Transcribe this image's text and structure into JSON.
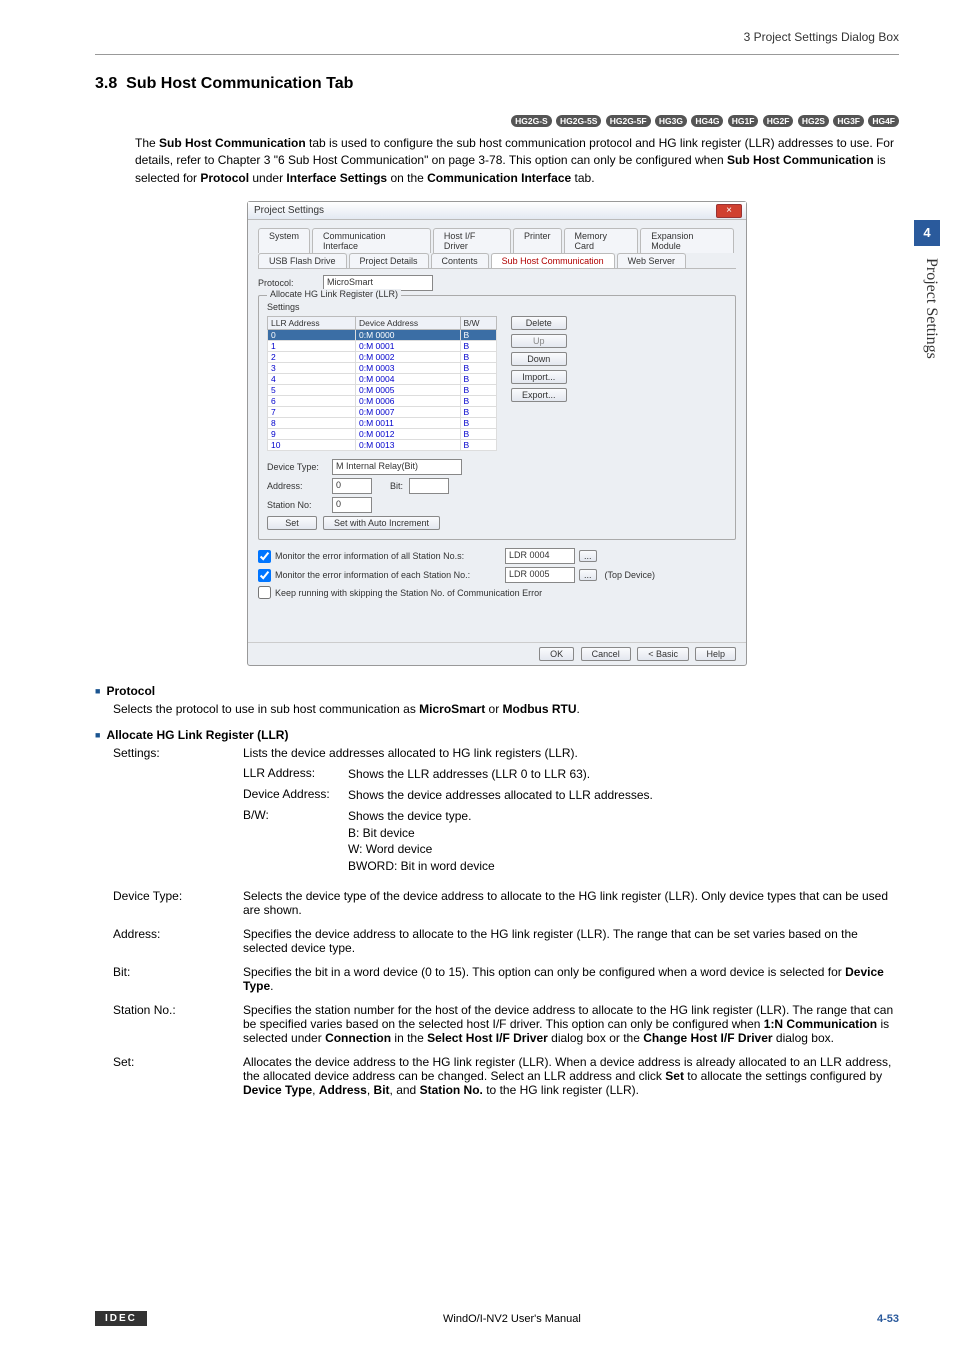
{
  "header": {
    "chapter": "3 Project Settings Dialog Box"
  },
  "section": {
    "num": "3.8",
    "title": "Sub Host Communication Tab"
  },
  "badges": [
    "HG2G-S",
    "HG2G-5S",
    "HG2G-5F",
    "HG3G",
    "HG4G",
    "HG1F",
    "HG2F",
    "HG2S",
    "HG3F",
    "HG4F"
  ],
  "intro": {
    "l1a": "The ",
    "l1b": "Sub Host Communication",
    "l1c": " tab is used to configure the sub host communication protocol and HG link register (LLR) addresses to use. For details, refer to Chapter 3 \"6 Sub Host Communication\" on page 3-78. This option can only be configured when ",
    "l1d": "Sub Host Communication",
    "l1e": " is selected for ",
    "l1f": "Protocol",
    "l1g": " under ",
    "l1h": "Interface Settings",
    "l1i": " on the ",
    "l1j": "Communication Interface",
    "l1k": " tab."
  },
  "dialog": {
    "title": "Project Settings",
    "tabs_row1": [
      "System",
      "Communication Interface",
      "Host I/F Driver",
      "Printer",
      "Memory Card",
      "Expansion Module"
    ],
    "tabs_row2": [
      "USB Flash Drive",
      "Project Details",
      "Contents",
      "Sub Host Communication",
      "Web Server"
    ],
    "active_tab": "Sub Host Communication",
    "protocol_label": "Protocol:",
    "protocol_value": "MicroSmart",
    "group_title": "Allocate HG Link Register (LLR)",
    "settings_label": "Settings",
    "table_headers": [
      "LLR Address",
      "Device Address",
      "B/W"
    ],
    "table_rows": [
      {
        "llr": "0",
        "dev": "0:M 0000",
        "bw": "B",
        "sel": true
      },
      {
        "llr": "1",
        "dev": "0:M 0001",
        "bw": "B"
      },
      {
        "llr": "2",
        "dev": "0:M 0002",
        "bw": "B"
      },
      {
        "llr": "3",
        "dev": "0:M 0003",
        "bw": "B"
      },
      {
        "llr": "4",
        "dev": "0:M 0004",
        "bw": "B"
      },
      {
        "llr": "5",
        "dev": "0:M 0005",
        "bw": "B"
      },
      {
        "llr": "6",
        "dev": "0:M 0006",
        "bw": "B"
      },
      {
        "llr": "7",
        "dev": "0:M 0007",
        "bw": "B"
      },
      {
        "llr": "8",
        "dev": "0:M 0011",
        "bw": "B"
      },
      {
        "llr": "9",
        "dev": "0:M 0012",
        "bw": "B"
      },
      {
        "llr": "10",
        "dev": "0:M 0013",
        "bw": "B"
      }
    ],
    "buttons": {
      "delete": "Delete",
      "up": "Up",
      "down": "Down",
      "import": "Import...",
      "export": "Export..."
    },
    "device_type_label": "Device Type:",
    "device_type_value": "M  Internal Relay(Bit)",
    "address_label": "Address:",
    "address_value": "0",
    "bit_label": "Bit:",
    "station_label": "Station No:",
    "station_value": "0",
    "set_btn": "Set",
    "autoinc_btn": "Set with Auto Increment",
    "chk_all_label": "Monitor the error information of all Station No.s:",
    "chk_all_value": "LDR 0004",
    "chk_each_label": "Monitor the error information of each Station No.:",
    "chk_each_value": "LDR 0005",
    "chk_each_suffix": "(Top Device)",
    "chk_keep_label": "Keep running with skipping the Station No. of Communication Error",
    "dlg_buttons": {
      "ok": "OK",
      "cancel": "Cancel",
      "basic": "< Basic",
      "help": "Help"
    }
  },
  "protocol_section": {
    "head": "Protocol",
    "body_a": "Selects the protocol to use in sub host communication as ",
    "body_b": "MicroSmart",
    "body_c": " or ",
    "body_d": "Modbus RTU",
    "body_e": "."
  },
  "allocate_section": {
    "head": "Allocate HG Link Register (LLR)"
  },
  "fields": {
    "settings": {
      "label": "Settings:",
      "desc": "Lists the device addresses allocated to HG link registers (LLR).",
      "llr": {
        "label": "LLR Address:",
        "val": "Shows the LLR addresses (LLR 0 to LLR 63)."
      },
      "dev": {
        "label": "Device Address:",
        "val": "Shows the device addresses allocated to LLR addresses."
      },
      "bw": {
        "label": "B/W:",
        "val1": "Shows the device type.",
        "val2": "B: Bit device",
        "val3": "W: Word device",
        "val4": "BWORD: Bit in word device"
      }
    },
    "device_type": {
      "label": "Device Type:",
      "val": "Selects the device type of the device address to allocate to the HG link register (LLR). Only device types that can be used are shown."
    },
    "address": {
      "label": "Address:",
      "val": "Specifies the device address to allocate to the HG link register (LLR). The range that can be set varies based on the selected device type."
    },
    "bit": {
      "label": "Bit:",
      "a": "Specifies the bit in a word device (0 to 15). This option can only be configured when a word device is selected for ",
      "b": "Device Type",
      "c": "."
    },
    "station": {
      "label": "Station No.:",
      "a": "Specifies the station number for the host of the device address to allocate to the HG link register (LLR). The range that can be specified varies based on the selected host I/F driver. This option can only be configured when ",
      "b": "1:N Communication",
      "c": " is selected under ",
      "d": "Connection",
      "e": " in the ",
      "f": "Select Host I/F Driver",
      "g": " dialog box or the ",
      "h": "Change Host I/F Driver",
      "i": " dialog box."
    },
    "set": {
      "label": "Set:",
      "a": "Allocates the device address to the HG link register (LLR). When a device address is already allocated to an LLR address, the allocated device address can be changed. Select an LLR address and click ",
      "b": "Set",
      "c": " to allocate the settings configured by ",
      "d": "Device Type",
      "e": ", ",
      "f": "Address",
      "g": ", ",
      "h": "Bit",
      "i": ", and ",
      "j": "Station No.",
      "k": " to the HG link register (LLR)."
    }
  },
  "side": {
    "num": "4",
    "label": "Project Settings"
  },
  "footer": {
    "logo": "IDEC",
    "center": "WindO/I-NV2 User's Manual",
    "page_prefix": "4-",
    "page_num": "53"
  }
}
